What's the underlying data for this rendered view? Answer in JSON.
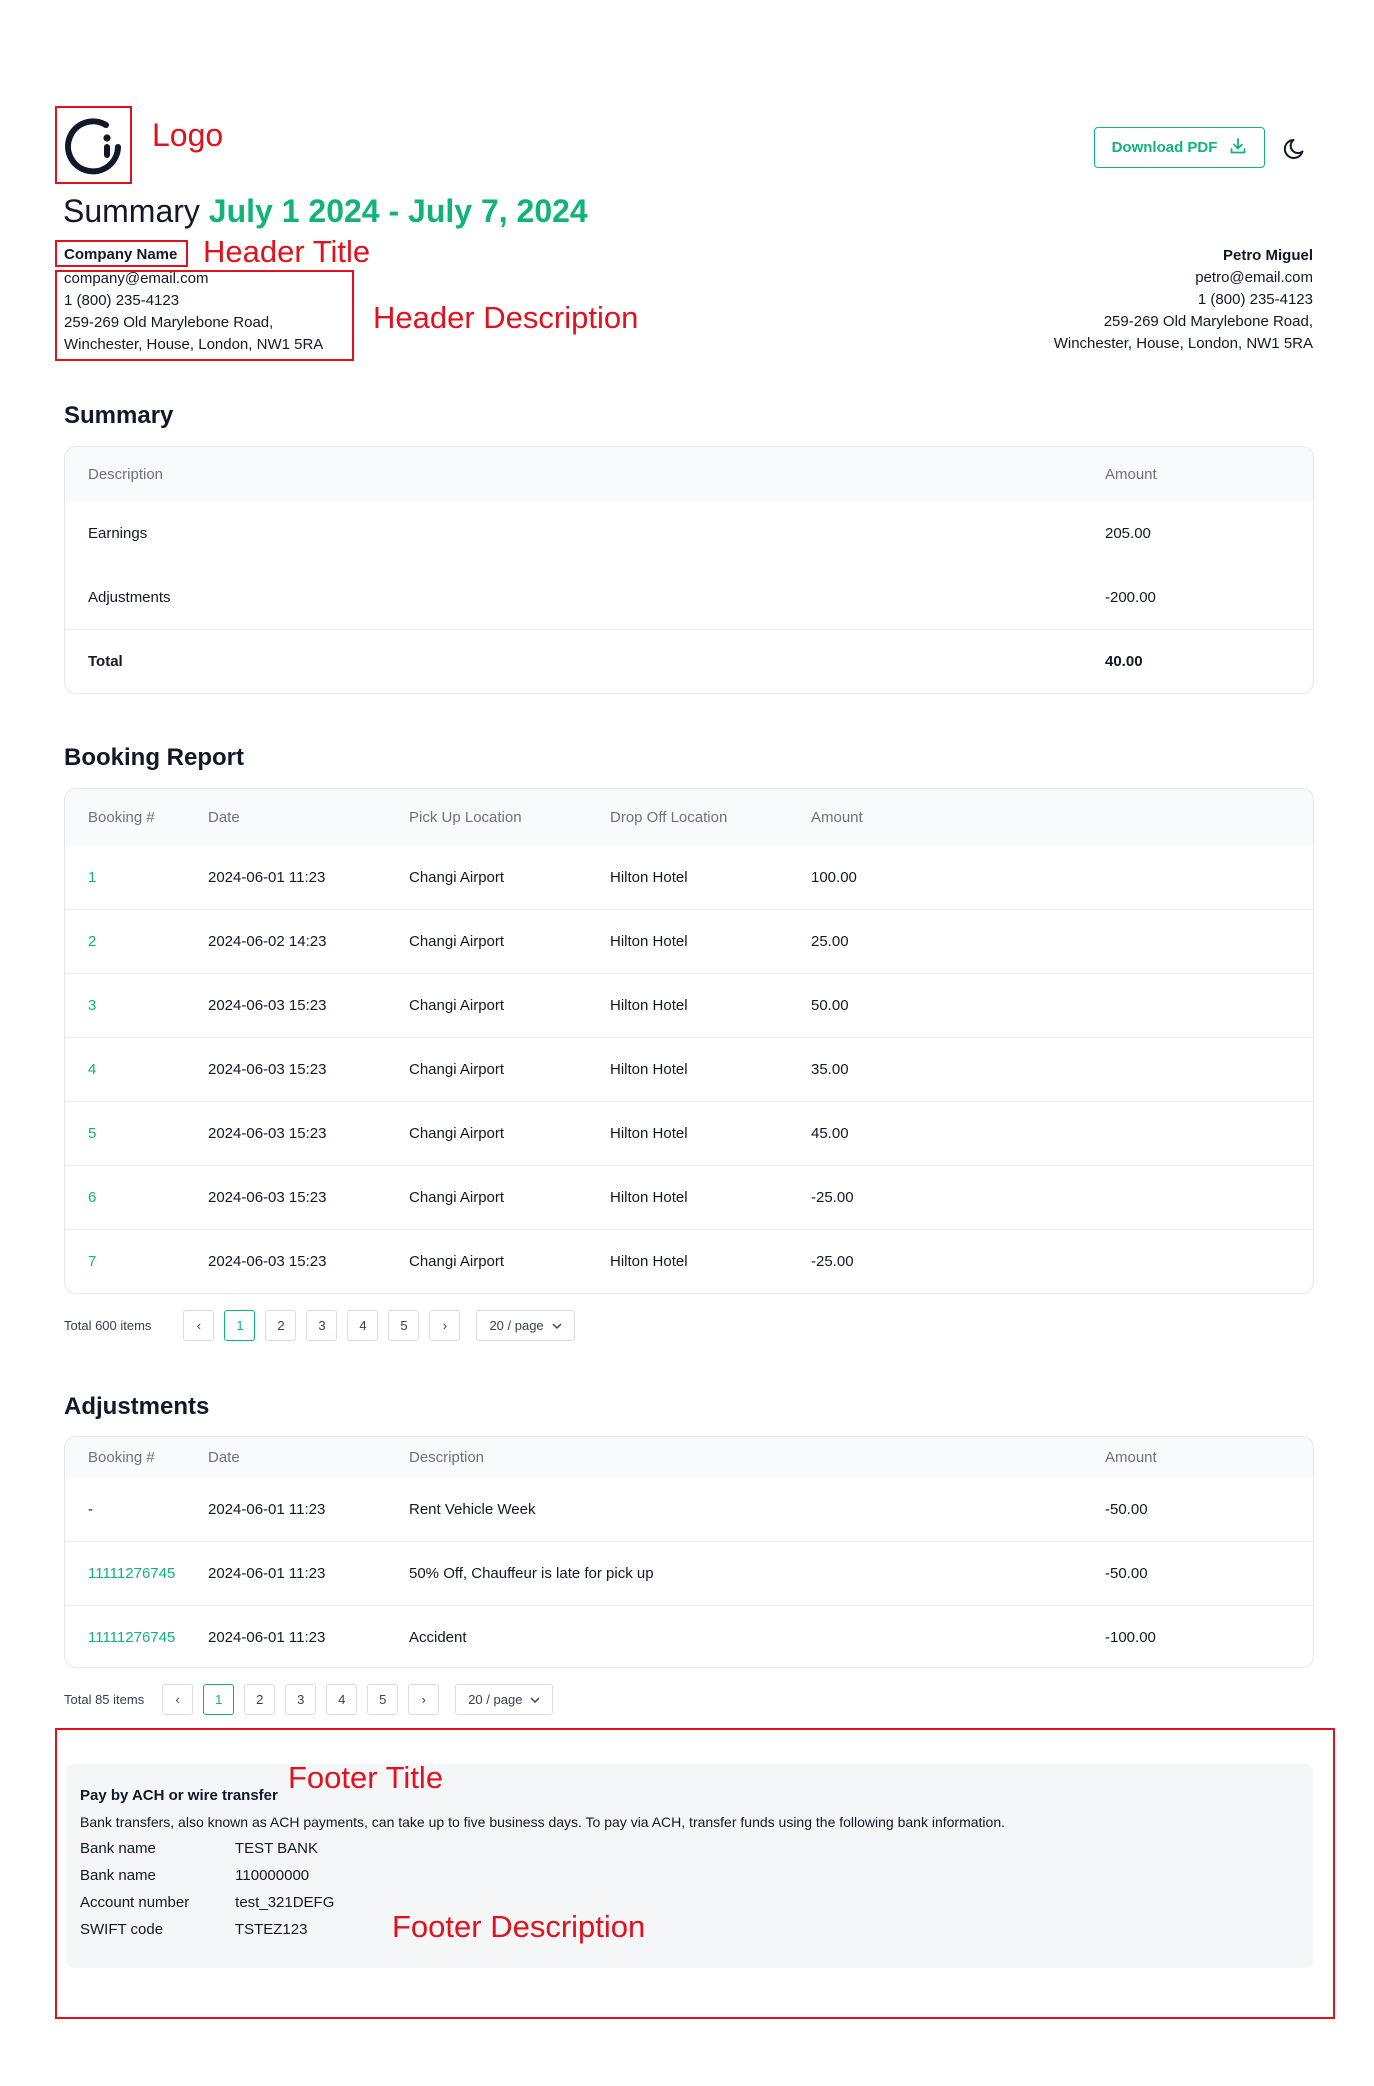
{
  "annotations": {
    "logo": "Logo",
    "header_title": "Header Title",
    "header_description": "Header Description",
    "footer_title": "Footer Title",
    "footer_description": "Footer Description"
  },
  "header": {
    "download_label": "Download PDF",
    "title_prefix": "Summary",
    "title_range": "July 1 2024 - July 7, 2024",
    "theme_icon": "moon-icon",
    "company": {
      "name": "Company Name",
      "email": "company@email.com",
      "phone": "1 (800) 235-4123",
      "address_1": "259-269 Old Marylebone Road,",
      "address_2": "Winchester, House, London, NW1 5RA"
    },
    "customer": {
      "name": "Petro Miguel",
      "email": "petro@email.com",
      "phone": "1 (800) 235-4123",
      "address_1": "259-269 Old Marylebone Road,",
      "address_2": "Winchester, House, London, NW1 5RA"
    }
  },
  "summary": {
    "title": "Summary",
    "columns": [
      "Description",
      "Amount"
    ],
    "rows": [
      {
        "description": "Earnings",
        "amount": "205.00"
      },
      {
        "description": "Adjustments",
        "amount": "-200.00"
      },
      {
        "description": "Total",
        "amount": "40.00"
      }
    ]
  },
  "booking": {
    "title": "Booking Report",
    "columns": [
      "Booking #",
      "Date",
      "Pick Up Location",
      "Drop Off Location",
      "Amount"
    ],
    "rows": [
      {
        "id": "1",
        "date": "2024-06-01 11:23",
        "pickup": "Changi Airport",
        "dropoff": "Hilton Hotel",
        "amount": "100.00"
      },
      {
        "id": "2",
        "date": "2024-06-02 14:23",
        "pickup": "Changi Airport",
        "dropoff": "Hilton Hotel",
        "amount": "25.00"
      },
      {
        "id": "3",
        "date": "2024-06-03 15:23",
        "pickup": "Changi Airport",
        "dropoff": "Hilton Hotel",
        "amount": "50.00"
      },
      {
        "id": "4",
        "date": "2024-06-03 15:23",
        "pickup": "Changi Airport",
        "dropoff": "Hilton Hotel",
        "amount": "35.00"
      },
      {
        "id": "5",
        "date": "2024-06-03 15:23",
        "pickup": "Changi Airport",
        "dropoff": "Hilton Hotel",
        "amount": "45.00"
      },
      {
        "id": "6",
        "date": "2024-06-03 15:23",
        "pickup": "Changi Airport",
        "dropoff": "Hilton Hotel",
        "amount": "-25.00"
      },
      {
        "id": "7",
        "date": "2024-06-03 15:23",
        "pickup": "Changi Airport",
        "dropoff": "Hilton Hotel",
        "amount": "-25.00"
      }
    ],
    "pagination": {
      "total": "Total 600 items",
      "pages": [
        "1",
        "2",
        "3",
        "4",
        "5"
      ],
      "current": "1",
      "page_size": "20 / page"
    }
  },
  "adjustments": {
    "title": "Adjustments",
    "columns": [
      "Booking #",
      "Date",
      "Description",
      "Amount"
    ],
    "rows": [
      {
        "id": "-",
        "date": "2024-06-01 11:23",
        "description": "Rent Vehicle Week",
        "amount": "-50.00"
      },
      {
        "id": "11111276745",
        "date": "2024-06-01 11:23",
        "description": "50% Off, Chauffeur is late for pick up",
        "amount": "-50.00"
      },
      {
        "id": "11111276745",
        "date": "2024-06-01 11:23",
        "description": "Accident",
        "amount": "-100.00"
      }
    ],
    "pagination": {
      "total": "Total 85 items",
      "pages": [
        "1",
        "2",
        "3",
        "4",
        "5"
      ],
      "current": "1",
      "page_size": "20 / page"
    }
  },
  "footer": {
    "title": "Pay by ACH or wire transfer",
    "description": "Bank transfers, also known as ACH payments, can take up to five business days. To pay via ACH, transfer funds using the following bank information.",
    "bank_details": [
      {
        "label": "Bank name",
        "value": "TEST BANK"
      },
      {
        "label": "Bank name",
        "value": "110000000"
      },
      {
        "label": "Account number",
        "value": "test_321DEFG"
      },
      {
        "label": "SWIFT code",
        "value": "TSTEZ123"
      }
    ]
  },
  "colors": {
    "accent": "#10b37a",
    "annotation": "#e0121e"
  }
}
